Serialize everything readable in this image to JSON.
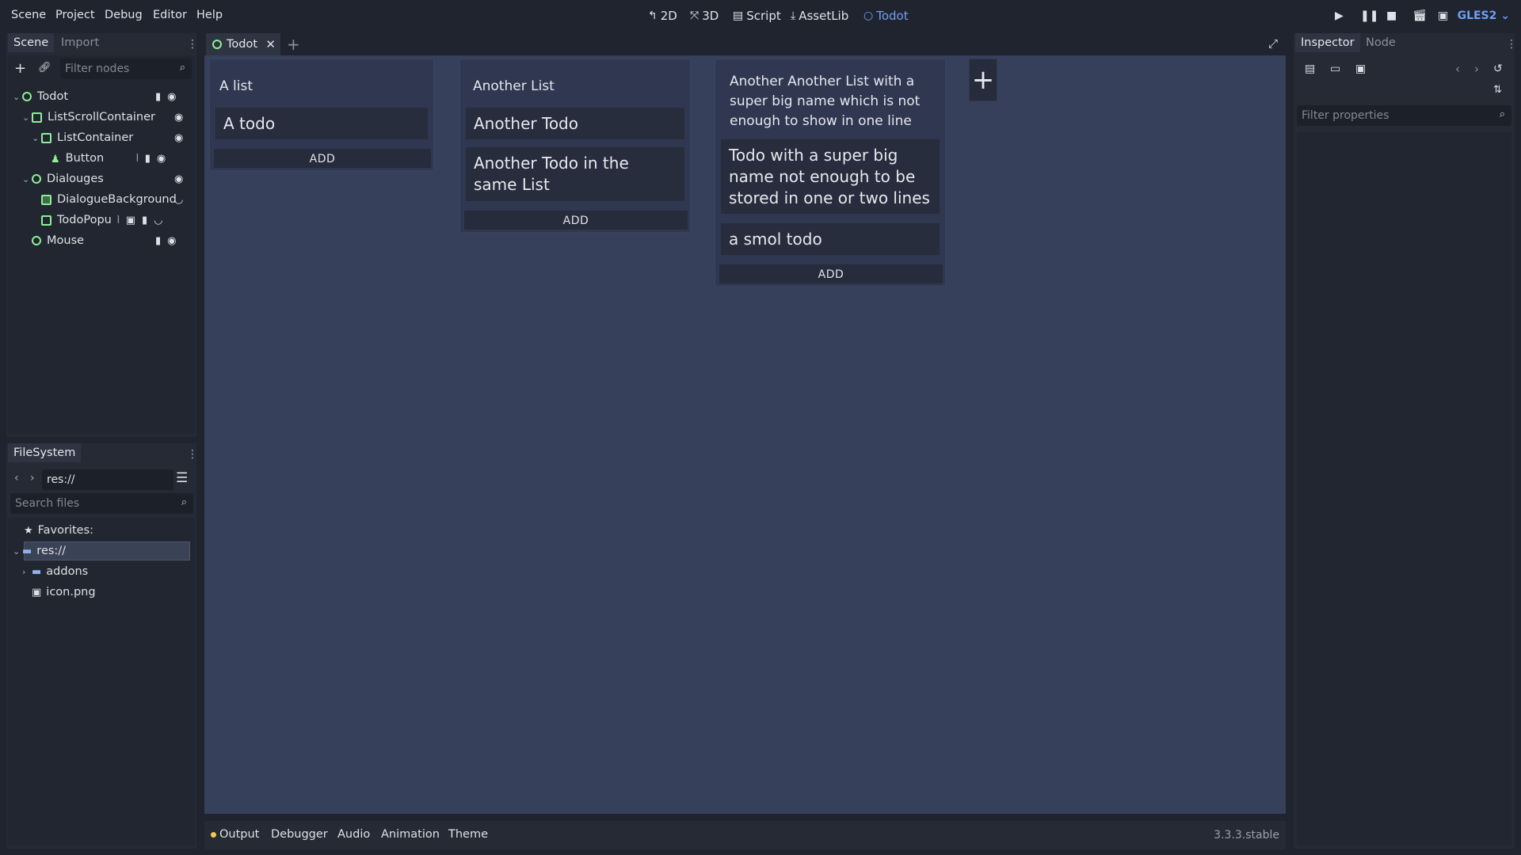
{
  "menu": [
    "Scene",
    "Project",
    "Debug",
    "Editor",
    "Help"
  ],
  "modes": [
    {
      "label": "2D",
      "icon": "2d-icon"
    },
    {
      "label": "3D",
      "icon": "3d-icon"
    },
    {
      "label": "Script",
      "icon": "script-icon"
    },
    {
      "label": "AssetLib",
      "icon": "assetlib-icon"
    },
    {
      "label": "Todot",
      "icon": "node-icon"
    }
  ],
  "renderer": "GLES2",
  "scene_panel": {
    "tabs": [
      "Scene",
      "Import"
    ],
    "filter_placeholder": "Filter nodes",
    "tree": [
      {
        "name": "Todot",
        "icon": "control-node-icon"
      },
      {
        "name": "ListScrollContainer",
        "icon": "scroll-container-icon"
      },
      {
        "name": "ListContainer",
        "icon": "hbox-container-icon"
      },
      {
        "name": "Button",
        "icon": "button-icon"
      },
      {
        "name": "Dialouges",
        "icon": "control-node-icon"
      },
      {
        "name": "DialogueBackground",
        "icon": "color-rect-icon"
      },
      {
        "name": "TodoPopu",
        "icon": "popup-icon"
      },
      {
        "name": "Mouse",
        "icon": "control-node-icon"
      }
    ]
  },
  "filesystem_panel": {
    "tab": "FileSystem",
    "path": "res://",
    "search_placeholder": "Search files",
    "favorites": "Favorites:",
    "root": "res://",
    "items": [
      "addons",
      "icon.png"
    ]
  },
  "editor_tabs": {
    "active": "Todot"
  },
  "todo_lists": [
    {
      "title": "A list",
      "todos": [
        "A todo"
      ],
      "add_label": "ADD"
    },
    {
      "title": "Another List",
      "todos": [
        "Another Todo",
        "Another Todo in the same List"
      ],
      "add_label": "ADD"
    },
    {
      "title": "Another Another List with a super big name which is not enough to show in one line",
      "todos": [
        "Todo with a super big name not enough to be stored in one or two lines",
        "a smol todo"
      ],
      "add_label": "ADD"
    }
  ],
  "add_list_label": "+",
  "bottom_tabs": [
    "Output",
    "Debugger",
    "Audio",
    "Animation",
    "Theme"
  ],
  "version": "3.3.3.stable",
  "inspector_panel": {
    "tabs": [
      "Inspector",
      "Node"
    ],
    "filter_placeholder": "Filter properties"
  }
}
